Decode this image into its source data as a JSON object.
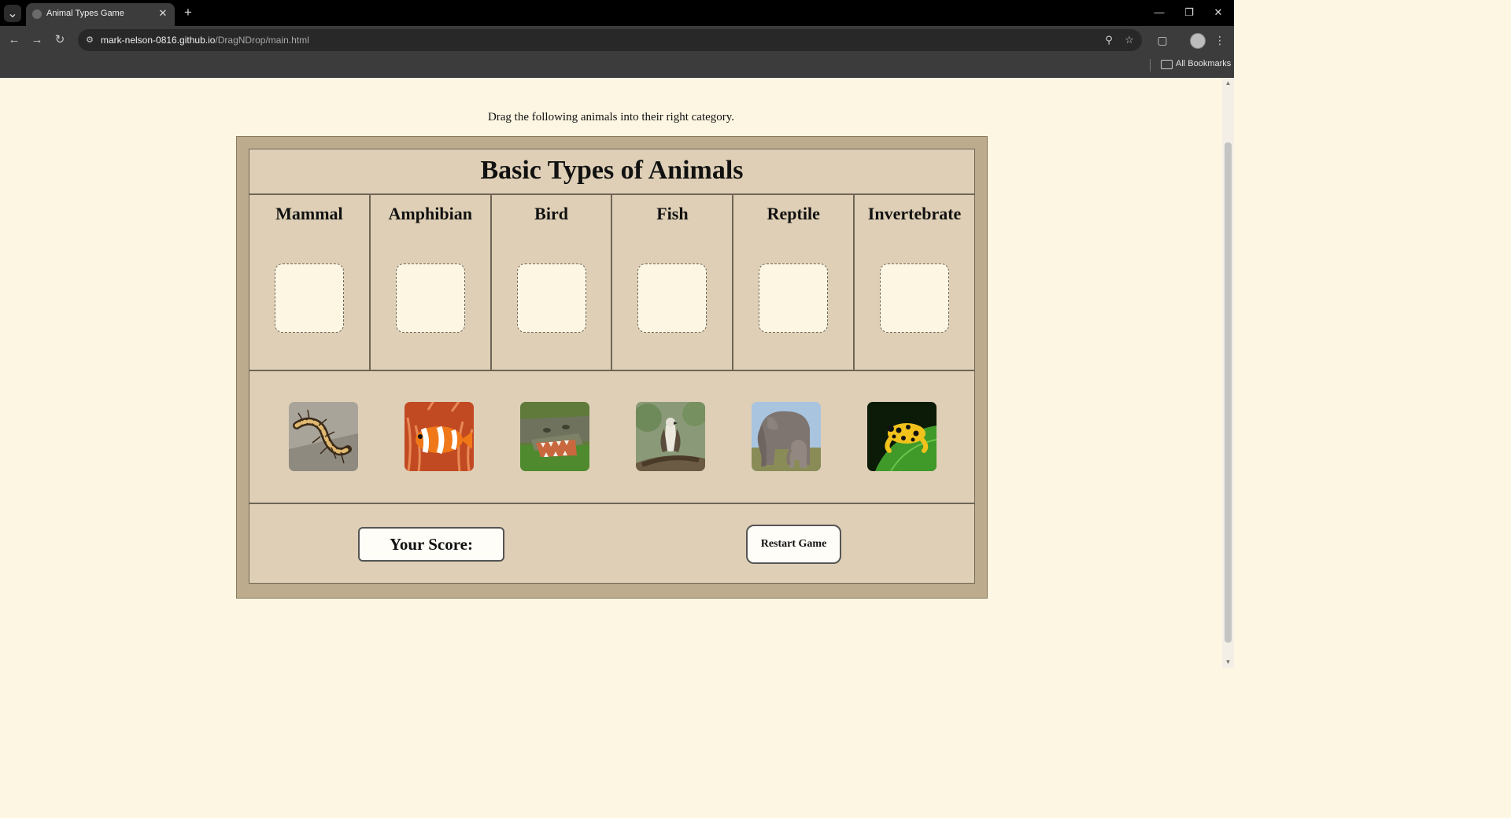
{
  "browser": {
    "tab_title": "Animal Types Game",
    "url_host": "mark-nelson-0816.github.io",
    "url_path": "/DragNDrop/main.html",
    "bookmarks_label": "All Bookmarks"
  },
  "page": {
    "instruction": "Drag the following animals into their right category.",
    "title": "Basic Types of Animals",
    "categories": [
      {
        "label": "Mammal"
      },
      {
        "label": "Amphibian"
      },
      {
        "label": "Bird"
      },
      {
        "label": "Fish"
      },
      {
        "label": "Reptile"
      },
      {
        "label": "Invertebrate"
      }
    ],
    "animals": [
      {
        "name": "centipede",
        "icon": "centipede-image"
      },
      {
        "name": "clownfish",
        "icon": "clownfish-image"
      },
      {
        "name": "crocodile",
        "icon": "crocodile-image"
      },
      {
        "name": "eagle",
        "icon": "eagle-image"
      },
      {
        "name": "elephant",
        "icon": "elephant-image"
      },
      {
        "name": "frog",
        "icon": "frog-image"
      }
    ],
    "score_label": "Your Score:",
    "restart_label": "Restart Game"
  },
  "colors": {
    "page_background": "#fdf6e3",
    "frame": "#bcab8c",
    "panel": "#decfb6"
  }
}
